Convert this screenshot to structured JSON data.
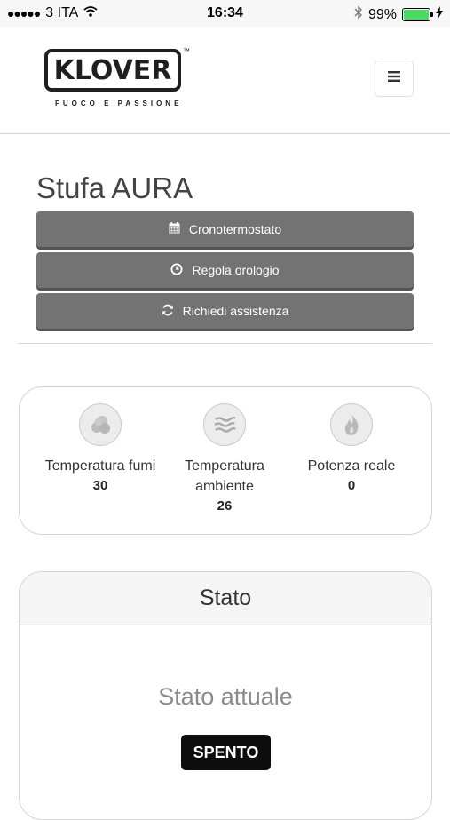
{
  "status_bar": {
    "signal_dots": "●●●●●",
    "carrier": "3 ITA",
    "time": "16:34",
    "battery_percent": "99%",
    "battery_level": 0.99,
    "battery_color": "#4cd964",
    "icons": [
      "wifi-icon",
      "bluetooth-icon",
      "charging-icon"
    ]
  },
  "header": {
    "brand": "KLOVER",
    "trademark": "™",
    "tagline": "FUOCO E PASSIONE",
    "menu_icon": "hamburger-icon"
  },
  "page": {
    "title": "Stufa AURA",
    "actions": [
      {
        "label": "Cronotermostato",
        "icon": "calendar-icon"
      },
      {
        "label": "Regola orologio",
        "icon": "clock-icon"
      },
      {
        "label": "Richiedi assistenza",
        "icon": "refresh-icon"
      }
    ]
  },
  "sensors": [
    {
      "label": "Temperatura fumi",
      "value": "30",
      "icon": "smoke-icon"
    },
    {
      "label": "Temperatura ambiente",
      "value": "26",
      "icon": "air-waves-icon"
    },
    {
      "label": "Potenza reale",
      "value": "0",
      "icon": "flame-icon"
    }
  ],
  "state_panel": {
    "title": "Stato",
    "subtitle": "Stato attuale",
    "status": "SPENTO"
  },
  "colors": {
    "button_bg": "#737373",
    "badge_bg": "#0d0d0d"
  }
}
